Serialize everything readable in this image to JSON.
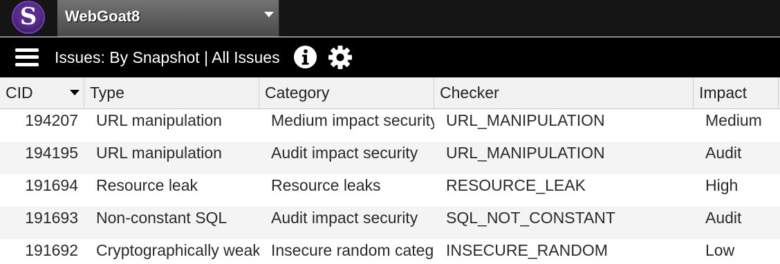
{
  "app": {
    "logo_letter": "S",
    "brand_color": "#5a2d91"
  },
  "project": {
    "name": "WebGoat8"
  },
  "nav": {
    "view_title": "Issues: By Snapshot | All Issues"
  },
  "table": {
    "columns": [
      "CID",
      "Type",
      "Category",
      "Checker",
      "Impact"
    ],
    "sorted_by": "CID",
    "rows": [
      {
        "cid": "194207",
        "type": "URL manipulation",
        "category": "Medium impact security",
        "checker": "URL_MANIPULATION",
        "impact": "Medium"
      },
      {
        "cid": "194195",
        "type": "URL manipulation",
        "category": "Audit impact security",
        "checker": "URL_MANIPULATION",
        "impact": "Audit"
      },
      {
        "cid": "191694",
        "type": "Resource leak",
        "category": "Resource leaks",
        "checker": "RESOURCE_LEAK",
        "impact": "High"
      },
      {
        "cid": "191693",
        "type": "Non-constant SQL",
        "category": "Audit impact security",
        "checker": "SQL_NOT_CONSTANT",
        "impact": "Audit"
      },
      {
        "cid": "191692",
        "type": "Cryptographically weak",
        "category": "Insecure random category",
        "checker": "INSECURE_RANDOM",
        "impact": "Low"
      }
    ]
  }
}
